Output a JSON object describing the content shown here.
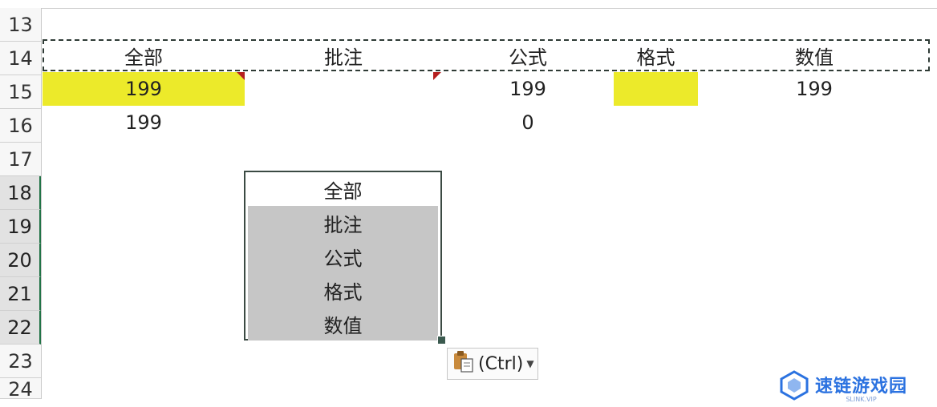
{
  "rows": [
    "13",
    "14",
    "15",
    "16",
    "17",
    "18",
    "19",
    "20",
    "21",
    "22",
    "23",
    "24"
  ],
  "header_row": [
    "全部",
    "批注",
    "公式",
    "格式",
    "数值"
  ],
  "row15": {
    "all": "199",
    "formula": "199",
    "value": "199"
  },
  "row16": {
    "all": "199",
    "formula": "0"
  },
  "dropdown": {
    "items": [
      "全部",
      "批注",
      "公式",
      "格式",
      "数值"
    ]
  },
  "paste_options": {
    "label": "(Ctrl)",
    "icon": "clipboard-paste-icon"
  },
  "watermark": {
    "name": "速链游戏园",
    "sub": "SLINK.VIP",
    "icon": "cube-logo-icon"
  },
  "colors": {
    "highlight": "#ecea2a",
    "comment_marker": "#b51f1f",
    "selection": "#c6c6c6"
  }
}
